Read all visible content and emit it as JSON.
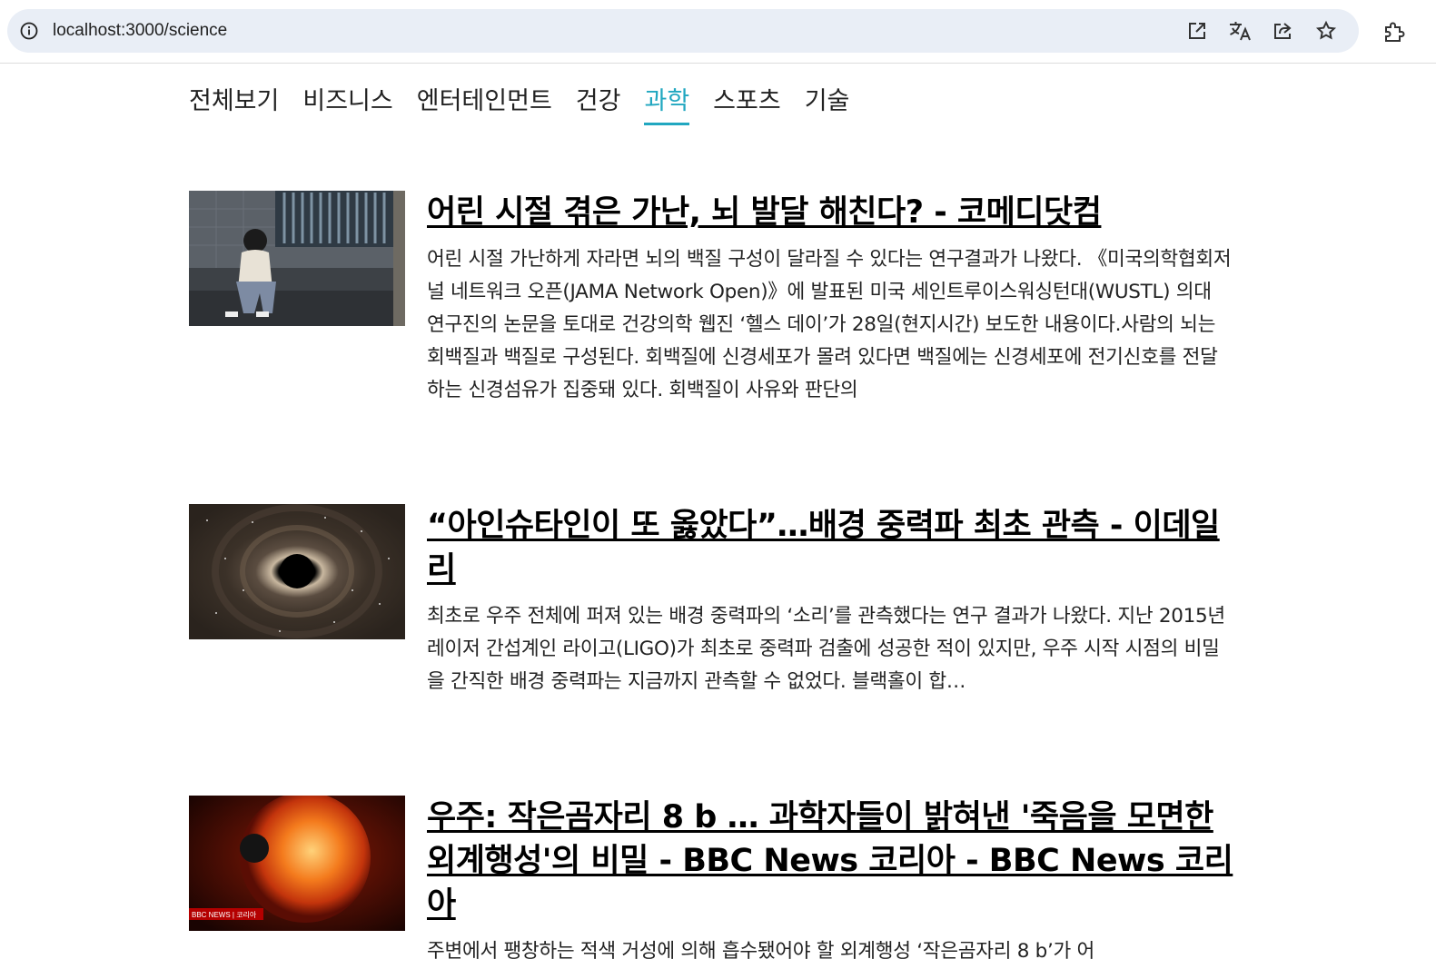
{
  "browser": {
    "url": "localhost:3000/science"
  },
  "nav": {
    "items": [
      {
        "label": "전체보기"
      },
      {
        "label": "비즈니스"
      },
      {
        "label": "엔터테인먼트"
      },
      {
        "label": "건강"
      },
      {
        "label": "과학",
        "active": true
      },
      {
        "label": "스포츠"
      },
      {
        "label": "기술"
      }
    ],
    "active_color": "#21a7c0"
  },
  "articles": [
    {
      "title": "어린 시절 겪은 가난, 뇌 발달 해친다? - 코메디닷컴",
      "description": "어린 시절 가난하게 자라면 뇌의 백질 구성이 달라질 수 있다는 연구결과가 나왔다. 《미국의학협회저널 네트워크 오픈(JAMA Network Open)》에 발표된 미국 세인트루이스워싱턴대(WUSTL) 의대 연구진의 논문을 토대로 건강의학 웹진 ‘헬스 데이’가 28일(현지시간) 보도한 내용이다.사람의 뇌는 회백질과 백질로 구성된다. 회백질에 신경세포가 몰려 있다면 백질에는 신경세포에 전기신호를 전달하는 신경섬유가 집중돼 있다. 회백질이 사유와 판단의",
      "image": "child-sitting-photo"
    },
    {
      "title": "“아인슈타인이 또 옳았다”…배경 중력파 최초 관측 - 이데일리",
      "description": "최초로 우주 전체에 퍼져 있는 배경 중력파의 ‘소리’를 관측했다는 연구 결과가 나왔다. 지난 2015년 레이저 간섭계인 라이고(LIGO)가 최초로 중력파 검출에 성공한 적이 있지만, 우주 시작 시점의 비밀을 간직한 배경 중력파는 지금까지 관측할 수 없었다. 블랙홀이 합…",
      "image": "black-hole-photo"
    },
    {
      "title": "우주: 작은곰자리 8 b … 과학자들이 밝혀낸 '죽음을 모면한 외계행성'의 비밀 - BBC News 코리아 - BBC News 코리아",
      "description": "주변에서 팽창하는 적색 거성에 의해 흡수됐어야 할 외계행성 ‘작은곰자리 8 b’가 어",
      "image": "red-giant-photo",
      "image_caption": "BBC NEWS | 코리아"
    }
  ]
}
